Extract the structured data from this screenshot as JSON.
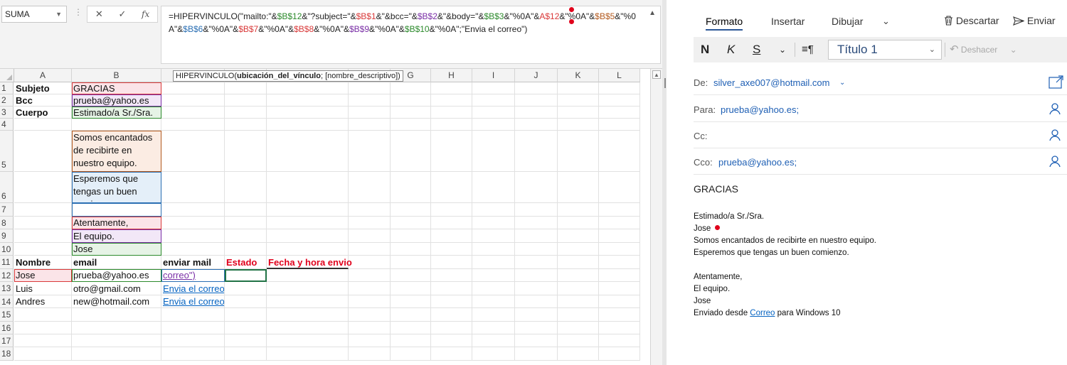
{
  "excel": {
    "namebox": "SUMA",
    "formula_buttons": {
      "cancel": "✕",
      "enter": "✓",
      "fx": "fx"
    },
    "formula_parts": [
      {
        "t": "=HIPERVINCULO(\"mailto:\"&",
        "c": ""
      },
      {
        "t": "$B$12",
        "c": "r1"
      },
      {
        "t": "&\"?subject=\"&",
        "c": ""
      },
      {
        "t": "$B$1",
        "c": "r2"
      },
      {
        "t": "&\"&bcc=\"&",
        "c": ""
      },
      {
        "t": "$B$2",
        "c": "r3"
      },
      {
        "t": "&\"&body=\"&",
        "c": ""
      },
      {
        "t": "$B$3",
        "c": "r1"
      },
      {
        "t": "&\"%0A\"&",
        "c": ""
      },
      {
        "t": "A$12",
        "c": "r2"
      },
      {
        "t": "&\"%0A\"&",
        "c": ""
      },
      {
        "t": "$B$5",
        "c": "r4"
      },
      {
        "t": "&\"%0A\"&",
        "c": ""
      },
      {
        "t": "$B$6",
        "c": "r5"
      },
      {
        "t": "&\"%0A\"&",
        "c": ""
      },
      {
        "t": "$B$7",
        "c": "r2"
      },
      {
        "t": "&\"%0A\"&",
        "c": ""
      },
      {
        "t": "$B$8",
        "c": "r2"
      },
      {
        "t": "&\"%0A\"&",
        "c": ""
      },
      {
        "t": "$B$9",
        "c": "r3"
      },
      {
        "t": "&\"%0A\"&",
        "c": ""
      },
      {
        "t": "$B$10",
        "c": "r1"
      },
      {
        "t": "&\"%0A\";\"Envia el correo\")",
        "c": ""
      }
    ],
    "tooltip": {
      "func": "HIPERVINCULO(",
      "arg1": "ubicación_del_vínculo",
      "rest": "; [nombre_descriptivo])"
    },
    "columns": [
      "A",
      "B",
      "C",
      "D",
      "E",
      "F",
      "G",
      "H",
      "I",
      "J",
      "K",
      "L"
    ],
    "rows": [
      "1",
      "2",
      "3",
      "4",
      "5",
      "6",
      "7",
      "8",
      "9",
      "10",
      "11",
      "12",
      "13",
      "14",
      "15",
      "16",
      "17",
      "18"
    ],
    "cells": {
      "A1": "Subjeto",
      "B1": "GRACIAS",
      "A2": "Bcc",
      "B2": "prueba@yahoo.es",
      "A3": "Cuerpo",
      "B3": "Estimado/a Sr./Sra.",
      "B5": "Somos encantados de recibirte en nuestro equipo.",
      "B6": "Esperemos que tengas un buen comienzo.",
      "B8": "Atentamente,",
      "B9": "El equipo.",
      "B10": "Jose",
      "A11": "Nombre",
      "B11": "email",
      "C11": "enviar mail",
      "D11": "Estado",
      "E11": "Fecha y hora envio",
      "A12": "Jose",
      "B12": "prueba@yahoo.es",
      "C12": "correo\")",
      "A13": "Luis",
      "B13": "otro@gmail.com",
      "C13": "Envia el correo",
      "A14": "Andres",
      "B14": "new@hotmail.com",
      "C14": "Envia el correo"
    }
  },
  "mail": {
    "tabs": [
      "Formato",
      "Insertar",
      "Dibujar"
    ],
    "tab_more": "⌄",
    "discard_label": "Descartar",
    "send_label": "Enviar",
    "toolbar": {
      "bold": "N",
      "italic": "K",
      "underline": "S",
      "style": "Título 1",
      "undo": "Deshacer"
    },
    "from_label": "De:",
    "from_value": "silver_axe007@hotmail.com",
    "to_label": "Para:",
    "to_value": "prueba@yahoo.es;",
    "cc_label": "Cc:",
    "bcc_label": "Cco:",
    "bcc_value": "prueba@yahoo.es;",
    "subject": "GRACIAS",
    "body_lines": [
      "Estimado/a Sr./Sra.",
      "Jose",
      "Somos encantados de recibirte en nuestro equipo.",
      "Esperemos que tengas un buen comienzo.",
      "",
      "Atentamente,",
      "El equipo.",
      "Jose"
    ],
    "sent_from_prefix": "Enviado desde ",
    "sent_from_link": "Correo",
    "sent_from_suffix": " para Windows 10",
    "accent_color": "#2b5797",
    "link_color": "#1e5fb4"
  }
}
